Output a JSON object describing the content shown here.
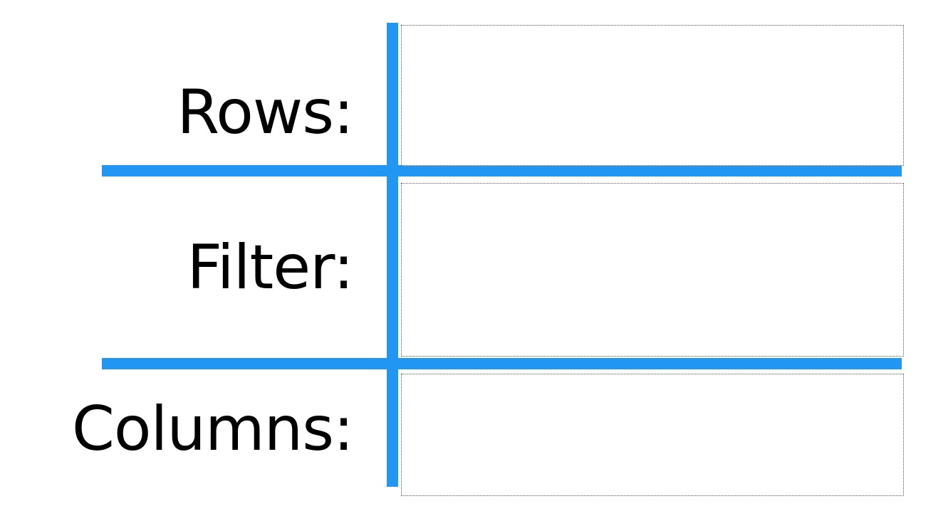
{
  "panels": {
    "rows": {
      "label": "Rows:"
    },
    "filter": {
      "label": "Filter:"
    },
    "columns": {
      "label": "Columns:"
    }
  },
  "colors": {
    "divider": "#2196f3",
    "text": "#000000",
    "dropzone_border": "#555555",
    "background": "#ffffff"
  }
}
